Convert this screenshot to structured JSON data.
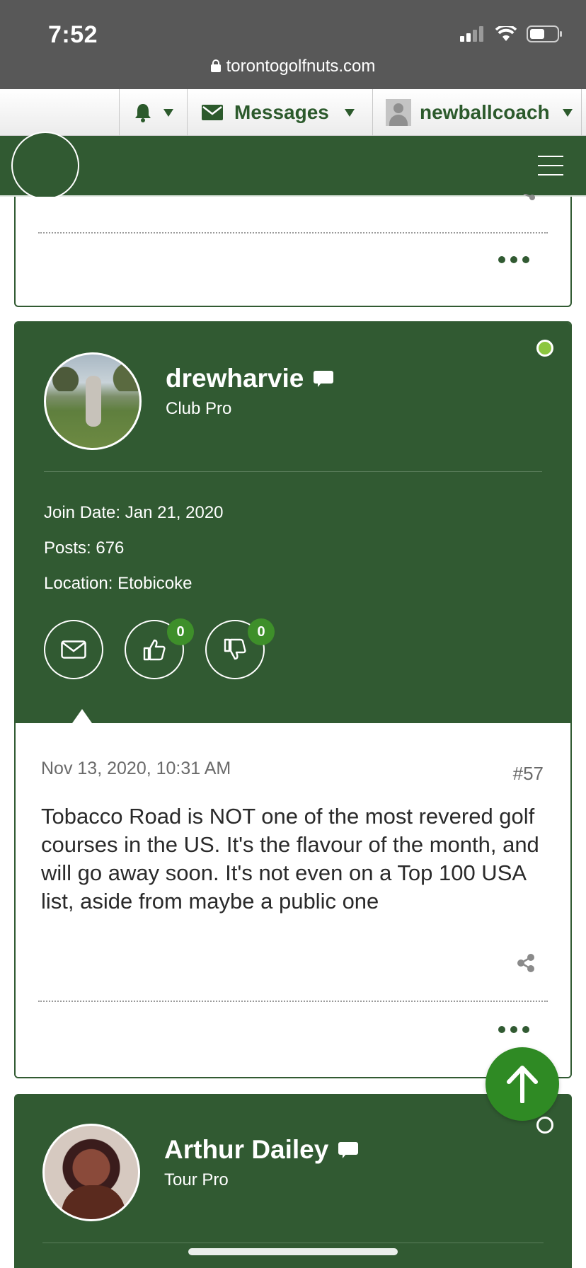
{
  "status_bar": {
    "time": "7:52",
    "url": "torontogolfnuts.com"
  },
  "toolbar": {
    "messages_label": "Messages",
    "username": "newballcoach"
  },
  "post": {
    "author": "drewharvie",
    "rank": "Club Pro",
    "join_date": "Join Date: Jan 21, 2020",
    "posts": "Posts: 676",
    "location": "Location: Etobicoke",
    "likes": "0",
    "dislikes": "0",
    "date": "Nov 13, 2020, 10:31 AM",
    "number": "#57",
    "text": "Tobacco Road is NOT one of the most revered golf courses in the US. It's the flavour of the month, and will go away soon. It's not even on a Top 100 USA list, aside from maybe a public one"
  },
  "next_post": {
    "author": "Arthur Dailey",
    "rank": "Tour Pro"
  },
  "colors": {
    "forum_green": "#315a32",
    "online": "#8cc63f",
    "badge": "#3e8f2a",
    "scroll_top": "#2f8a24"
  }
}
